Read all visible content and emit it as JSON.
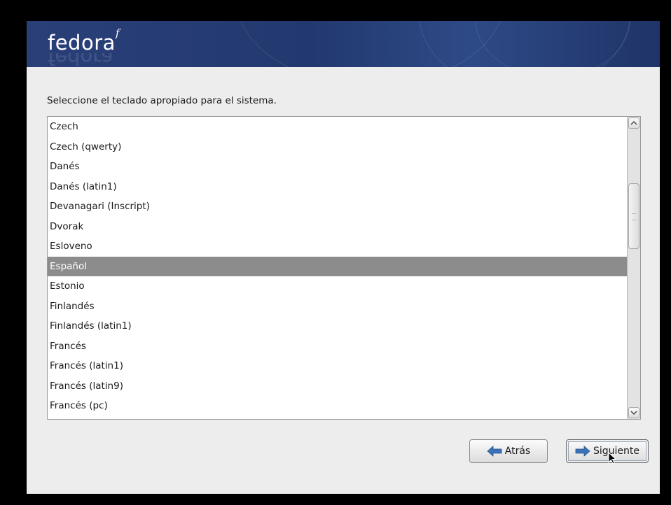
{
  "header": {
    "logo_text": "fedora",
    "logo_mark": "f"
  },
  "main": {
    "prompt": "Seleccione el teclado apropiado para el sistema."
  },
  "keyboard_list": {
    "items": [
      {
        "label": "Czech"
      },
      {
        "label": "Czech (qwerty)"
      },
      {
        "label": "Danés"
      },
      {
        "label": "Danés (latin1)"
      },
      {
        "label": "Devanagari (Inscript)"
      },
      {
        "label": "Dvorak"
      },
      {
        "label": "Esloveno"
      },
      {
        "label": "Español"
      },
      {
        "label": "Estonio"
      },
      {
        "label": "Finlandés"
      },
      {
        "label": "Finlandés (latin1)"
      },
      {
        "label": "Francés"
      },
      {
        "label": "Francés (latin1)"
      },
      {
        "label": "Francés (latin9)"
      },
      {
        "label": "Francés (pc)"
      }
    ],
    "selected": "Español",
    "scroll_position": 0.25
  },
  "buttons": {
    "back_label": "Atrás",
    "back_icon": "arrow-left-icon",
    "next_label": "Siguiente",
    "next_icon": "arrow-right-icon"
  },
  "colors": {
    "banner": "#22396f",
    "selection": "#8c8c8c",
    "arrow": "#3b73b9"
  }
}
